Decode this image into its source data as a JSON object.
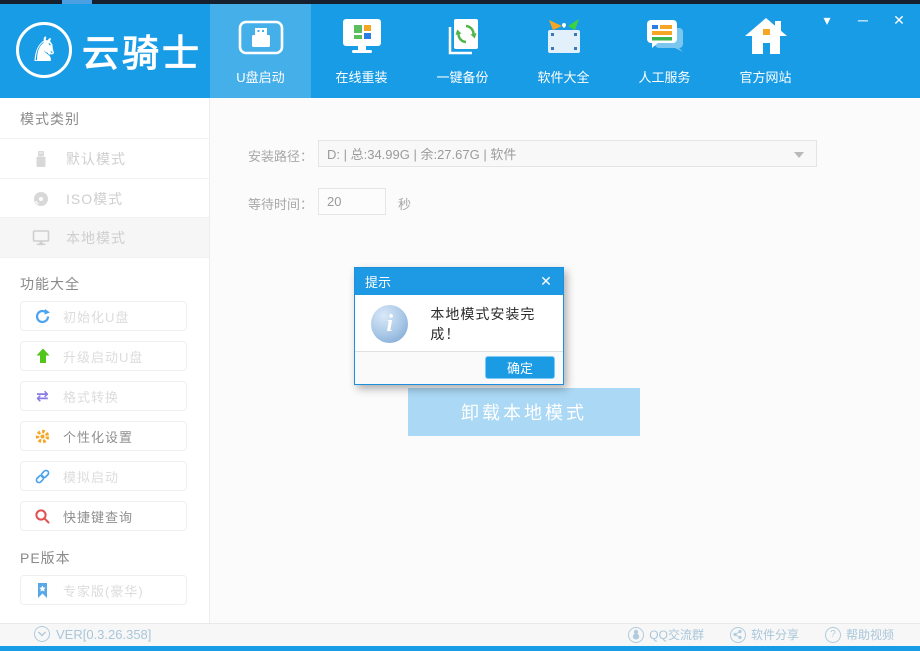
{
  "window": {
    "controls": {
      "dropdown": "▾",
      "minimize": "─",
      "close": "✕"
    }
  },
  "brand": {
    "name": "云骑士",
    "logo_icon": "knight-on-horse-icon"
  },
  "nav": {
    "items": [
      {
        "label": "U盘启动",
        "icon": "usb-boot-icon",
        "active": true
      },
      {
        "label": "在线重装",
        "icon": "online-reinstall-monitor-icon",
        "active": false
      },
      {
        "label": "一键备份",
        "icon": "one-key-backup-icon",
        "active": false
      },
      {
        "label": "软件大全",
        "icon": "software-collection-box-icon",
        "active": false
      },
      {
        "label": "人工服务",
        "icon": "customer-service-chat-icon",
        "active": false
      },
      {
        "label": "官方网站",
        "icon": "official-website-home-icon",
        "active": false
      }
    ]
  },
  "sidebar": {
    "mode_section": {
      "title": "模式类别",
      "items": [
        {
          "label": "默认模式",
          "icon": "usb-drive-icon",
          "selected": false
        },
        {
          "label": "ISO模式",
          "icon": "disc-icon",
          "selected": false
        },
        {
          "label": "本地模式",
          "icon": "monitor-icon",
          "selected": true
        }
      ]
    },
    "feature_section": {
      "title": "功能大全",
      "items": [
        {
          "label": "初始化U盘",
          "icon": "refresh-icon",
          "icon_color": "#4aa3f0",
          "enabled": false
        },
        {
          "label": "升级启动U盘",
          "icon": "up-arrow-icon",
          "icon_color": "#52c41a",
          "enabled": false
        },
        {
          "label": "格式转换",
          "icon": "transfer-arrows-icon",
          "icon_color": "#8a7ae8",
          "enabled": false
        },
        {
          "label": "个性化设置",
          "icon": "gear-icon",
          "icon_color": "#f5a623",
          "enabled": true
        },
        {
          "label": "模拟启动",
          "icon": "link-icon",
          "icon_color": "#4aa3f0",
          "enabled": false
        },
        {
          "label": "快捷键查询",
          "icon": "search-icon",
          "icon_color": "#e05252",
          "enabled": true
        }
      ]
    },
    "pe_section": {
      "title": "PE版本",
      "items": [
        {
          "label": "专家版(豪华)",
          "icon": "bookmark-icon"
        }
      ]
    }
  },
  "main": {
    "install_path": {
      "label": "安装路径：",
      "value": "D: | 总:34.99G | 余:27.67G | 软件"
    },
    "wait_time": {
      "label": "等待时间：",
      "value": "20",
      "unit": "秒"
    },
    "uninstall_button": "卸载本地模式"
  },
  "dialog": {
    "title": "提示",
    "close": "✕",
    "info_icon": "info-icon",
    "message": "本地模式安装完成！",
    "ok_label": "确定"
  },
  "footer": {
    "version": "VER[0.3.26.358]",
    "links": [
      {
        "label": "QQ交流群",
        "icon": "qq-penguin-icon"
      },
      {
        "label": "软件分享",
        "icon": "share-icon"
      },
      {
        "label": "帮助视频",
        "icon": "question-mark-icon"
      }
    ]
  },
  "colors": {
    "header_blue": "#199ce6",
    "active_tab_blue": "#45afea",
    "dialog_title_blue": "#1e9ae4",
    "ok_button_blue": "#1c9be5",
    "uninstall_light_blue": "#abd8f4",
    "footer_text_blue": "#a9c6da",
    "top_strip_dark": "#16202e"
  }
}
